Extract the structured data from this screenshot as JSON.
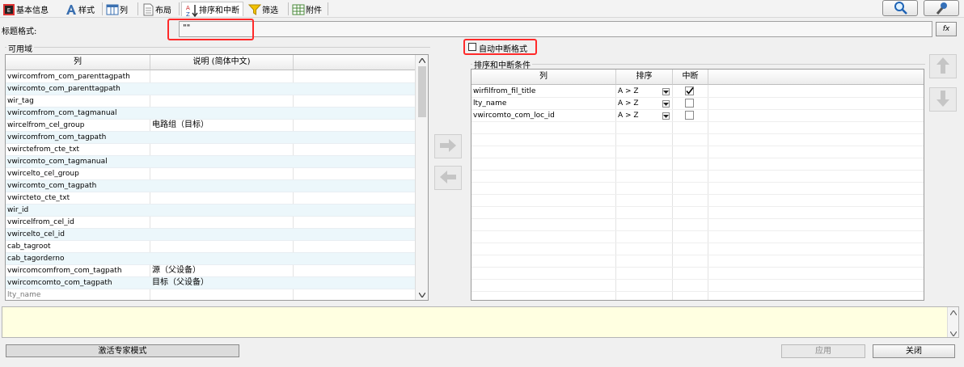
{
  "toolbar": {
    "tabs": [
      {
        "label": "基本信息",
        "icon": "app-icon"
      },
      {
        "label": "样式",
        "icon": "style-a-icon"
      },
      {
        "label": "列",
        "icon": "columns-icon"
      },
      {
        "label": "布局",
        "icon": "layout-page-icon"
      },
      {
        "label": "排序和中断",
        "icon": "sort-az-icon"
      },
      {
        "label": "筛选",
        "icon": "filter-funnel-icon"
      },
      {
        "label": "附件",
        "icon": "attachment-grid-icon"
      }
    ],
    "active_tab": "排序和中断",
    "right_buttons": [
      "preview-magnifier-icon",
      "tools-wrench-icon"
    ]
  },
  "title_format": {
    "label": "标题格式:",
    "value": "\"\"",
    "fx_label": "fx"
  },
  "available": {
    "group_title": "可用域",
    "headers": [
      "列",
      "说明 (简体中文)"
    ],
    "rows": [
      {
        "col": "vwircomfrom_com_parenttagpath",
        "desc": ""
      },
      {
        "col": "vwircomto_com_parenttagpath",
        "desc": ""
      },
      {
        "col": "wir_tag",
        "desc": ""
      },
      {
        "col": "vwircomfrom_com_tagmanual",
        "desc": ""
      },
      {
        "col": "wircelfrom_cel_group",
        "desc": "电路组（目标）"
      },
      {
        "col": "vwircomfrom_com_tagpath",
        "desc": ""
      },
      {
        "col": "vwirctefrom_cte_txt",
        "desc": ""
      },
      {
        "col": "vwircomto_com_tagmanual",
        "desc": ""
      },
      {
        "col": "vwircelto_cel_group",
        "desc": ""
      },
      {
        "col": "vwircomto_com_tagpath",
        "desc": ""
      },
      {
        "col": "vwircteto_cte_txt",
        "desc": ""
      },
      {
        "col": "wir_id",
        "desc": ""
      },
      {
        "col": "vwircelfrom_cel_id",
        "desc": ""
      },
      {
        "col": "vwircelto_cel_id",
        "desc": ""
      },
      {
        "col": "cab_tagroot",
        "desc": ""
      },
      {
        "col": "cab_tagorderno",
        "desc": ""
      },
      {
        "col": "vwircomcomfrom_com_tagpath",
        "desc": "源（父设备）"
      },
      {
        "col": "vwircomcomto_com_tagpath",
        "desc": "目标（父设备）"
      },
      {
        "col": "lty_name",
        "desc": ""
      }
    ]
  },
  "auto_break": {
    "label": "自动中断格式",
    "checked": false
  },
  "sort_break": {
    "group_title": "排序和中断条件",
    "headers": [
      "列",
      "排序",
      "中断"
    ],
    "rows": [
      {
        "col": "wirfilfrom_fil_title",
        "sort": "A > Z",
        "break": true
      },
      {
        "col": "lty_name",
        "sort": "A > Z",
        "break": false
      },
      {
        "col": "vwircomto_com_loc_id",
        "sort": "A > Z",
        "break": false
      }
    ]
  },
  "buttons": {
    "expert": "激活专家模式",
    "apply": "应用",
    "close": "关闭"
  },
  "colors": {
    "highlight_red": "#ff2a2a",
    "row_alt": "#ecf7fb",
    "message_bg": "#ffffe1"
  }
}
